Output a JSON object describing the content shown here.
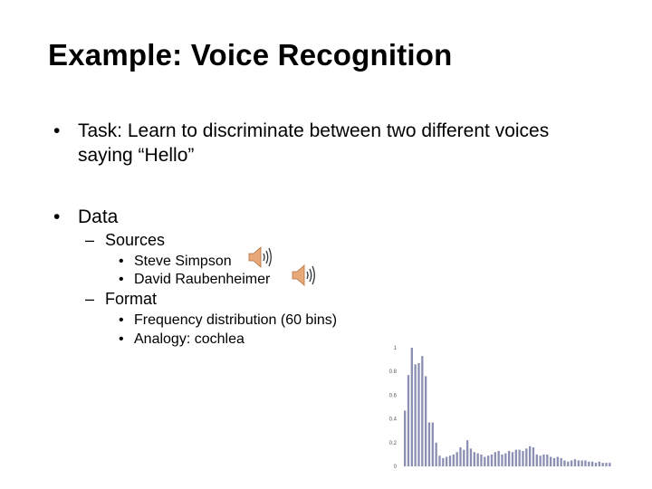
{
  "slide": {
    "title": "Example: Voice Recognition",
    "bullets": [
      {
        "marker": "•",
        "text": "Task: Learn to discriminate between two different voices saying “Hello”"
      },
      {
        "marker": "•",
        "text": "Data",
        "sub": [
          {
            "marker": "–",
            "text": "Sources",
            "items": [
              {
                "marker": "•",
                "text": "Steve Simpson",
                "icon": "speaker-icon"
              },
              {
                "marker": "•",
                "text": "David Raubenheimer",
                "icon": "speaker-icon"
              }
            ]
          },
          {
            "marker": "–",
            "text": "Format",
            "items": [
              {
                "marker": "•",
                "text": "Frequency distribution (60 bins)"
              },
              {
                "marker": "•",
                "text": "Analogy: cochlea"
              }
            ]
          }
        ]
      }
    ]
  },
  "colors": {
    "bar": "#8a8fb3",
    "speaker": "#e8a878"
  },
  "chart_data": {
    "type": "bar",
    "title": "",
    "xlabel": "",
    "ylabel": "",
    "ylim": [
      0,
      1
    ],
    "yticks": [
      "0",
      "0.2",
      "0.4",
      "0.6",
      "0.8",
      "1"
    ],
    "grid": false,
    "values": [
      0.47,
      0.77,
      1.0,
      0.86,
      0.87,
      0.93,
      0.76,
      0.37,
      0.37,
      0.2,
      0.09,
      0.07,
      0.08,
      0.09,
      0.1,
      0.12,
      0.16,
      0.14,
      0.22,
      0.15,
      0.12,
      0.11,
      0.1,
      0.08,
      0.09,
      0.1,
      0.12,
      0.13,
      0.1,
      0.11,
      0.13,
      0.12,
      0.14,
      0.14,
      0.13,
      0.15,
      0.17,
      0.16,
      0.1,
      0.09,
      0.1,
      0.1,
      0.08,
      0.07,
      0.08,
      0.07,
      0.05,
      0.04,
      0.05,
      0.06,
      0.05,
      0.05,
      0.05,
      0.04,
      0.04,
      0.03,
      0.04,
      0.03,
      0.03,
      0.03
    ]
  }
}
